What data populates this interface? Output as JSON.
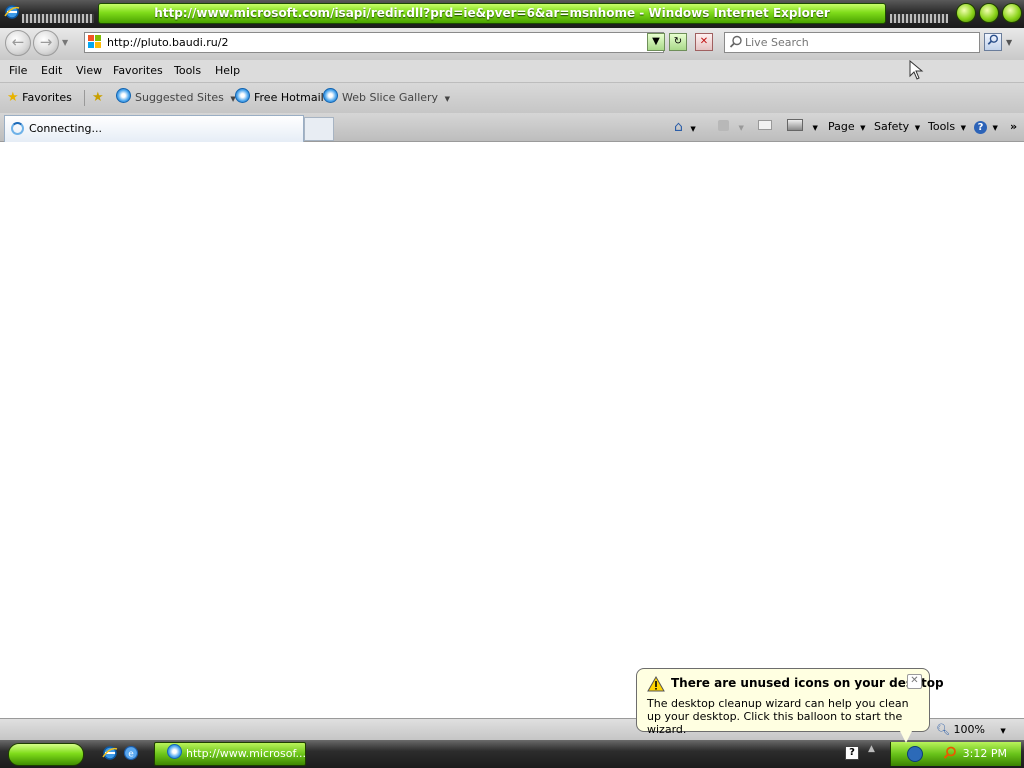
{
  "window": {
    "title": "http://www.microsoft.com/isapi/redir.dll?prd=ie&pver=6&ar=msnhome - Windows Internet Explorer"
  },
  "address": {
    "url": "http://pluto.baudi.ru/2"
  },
  "search": {
    "placeholder": "Live Search"
  },
  "menu": {
    "items": [
      "File",
      "Edit",
      "View",
      "Favorites",
      "Tools",
      "Help"
    ]
  },
  "favorites_bar": {
    "favorites_label": "Favorites",
    "suggested_sites": "Suggested Sites",
    "free_hotmail": "Free Hotmail",
    "web_slice_gallery": "Web Slice Gallery"
  },
  "tab": {
    "label": "Connecting..."
  },
  "command_bar": {
    "page": "Page",
    "safety": "Safety",
    "tools": "Tools"
  },
  "status_bar": {
    "zoom": "100%"
  },
  "taskbar": {
    "task_label": "http://www.microsof...",
    "clock": "3:12 PM"
  },
  "balloon": {
    "title": "There are unused icons on your desktop",
    "body": "The desktop cleanup wizard can help you clean up your desktop. Click this balloon to start the wizard."
  },
  "colors": {
    "accent_green": "#7fdc1a",
    "titlebar_dark": "#2a2a2a",
    "balloon_bg": "#ffffe1"
  }
}
